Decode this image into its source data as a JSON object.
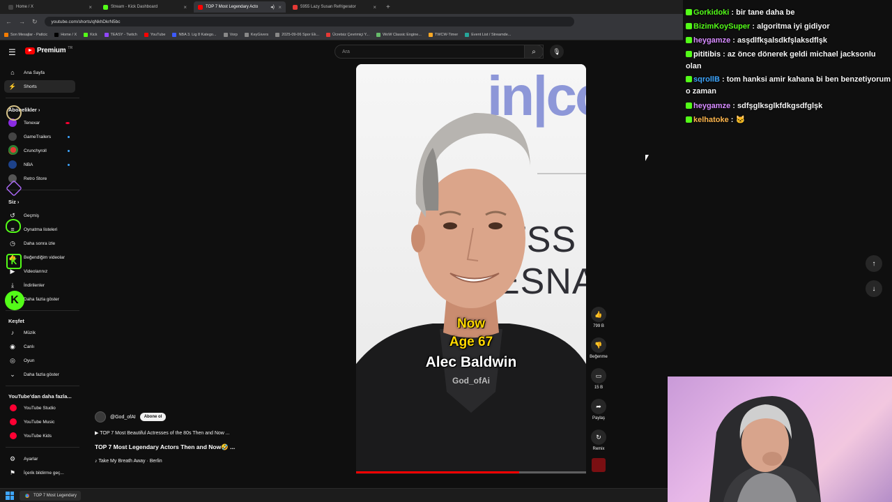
{
  "browser": {
    "tabs": [
      {
        "title": "Home / X",
        "color": "#000000",
        "active": false
      },
      {
        "title": "Stream - Kick Dashboard",
        "color": "#53fc18",
        "active": false
      },
      {
        "title": "TOP 7 Most Legendary Acto",
        "color": "#ff0000",
        "active": true
      },
      {
        "title": "5955 Lazy Susan Refrigerator",
        "color": "#e53935",
        "active": false
      }
    ],
    "url": "youtube.com/shorts/qNkhDkrN5bc",
    "bookmarks": [
      {
        "label": "Son Mesajlar - Patlcic",
        "color": "#f57c00"
      },
      {
        "label": "Home / X",
        "color": "#000000"
      },
      {
        "label": "Kick",
        "color": "#53fc18"
      },
      {
        "label": "TEASY - Twitch",
        "color": "#9146ff"
      },
      {
        "label": "YouTube",
        "color": "#ff0000"
      },
      {
        "label": "NBA 3. Lig 8 Katego...",
        "color": "#3d5afe"
      },
      {
        "label": "Vorp",
        "color": "#888888"
      },
      {
        "label": "KeyGivers",
        "color": "#888888"
      },
      {
        "label": "2025-09-06 Spor Ek...",
        "color": "#888888"
      },
      {
        "label": "Ücretsiz Çevrimiçi Y...",
        "color": "#e53935"
      },
      {
        "label": "WoW Classic Engine...",
        "color": "#66bb6a"
      },
      {
        "label": "TWCW-Timer",
        "color": "#f9a825"
      },
      {
        "label": "Event List / Streamde...",
        "color": "#26a69a"
      }
    ]
  },
  "youtube": {
    "logo_text": "Premium",
    "logo_region": "TR",
    "search_placeholder": "Ara",
    "sidebar": {
      "main": [
        {
          "label": "Ana Sayfa",
          "icon": "home-icon"
        },
        {
          "label": "Shorts",
          "icon": "shorts-icon",
          "active": true
        }
      ],
      "subscriptions_heading": "Abonelikler",
      "channels": [
        {
          "label": "Tenexar",
          "color": "#8a2be2"
        },
        {
          "label": "GameTrailers",
          "color": "#444444"
        },
        {
          "label": "Crunchyroll",
          "color": "#f47521"
        },
        {
          "label": "NBA",
          "color": "#1d428a"
        },
        {
          "label": "Retro Store",
          "color": "#555555"
        }
      ],
      "you_heading": "Siz",
      "you_items": [
        {
          "label": "Geçmiş",
          "icon": "history-icon"
        },
        {
          "label": "Oynatma listeleri",
          "icon": "playlist-icon"
        },
        {
          "label": "Daha sonra izle",
          "icon": "clock-icon"
        },
        {
          "label": "Beğendiğim videolar",
          "icon": "like-icon"
        },
        {
          "label": "Videolarınız",
          "icon": "video-icon"
        },
        {
          "label": "İndirilenler",
          "icon": "download-icon"
        },
        {
          "label": "Daha fazla göster",
          "icon": "chevron-down-icon"
        }
      ],
      "explore_heading": "Keşfet",
      "explore_items": [
        {
          "label": "Müzik",
          "icon": "music-icon"
        },
        {
          "label": "Canlı",
          "icon": "live-icon"
        },
        {
          "label": "Oyun",
          "icon": "gaming-icon"
        },
        {
          "label": "Daha fazla göster",
          "icon": "chevron-down-icon"
        }
      ],
      "more_heading": "YouTube'dan daha fazla...",
      "more_items": [
        {
          "label": "YouTube Studio"
        },
        {
          "label": "YouTube Music"
        },
        {
          "label": "YouTube Kids"
        }
      ],
      "settings_items": [
        {
          "label": "Ayarlar",
          "icon": "gear-icon"
        },
        {
          "label": "İçerik bildirme geç...",
          "icon": "flag-icon"
        }
      ]
    },
    "short": {
      "captions": {
        "now": "Now",
        "age": "Age 67",
        "name": "Alec Baldwin",
        "watermark": "God_ofAi"
      },
      "progress": 0.71,
      "channel_handle": "@God_ofAI",
      "subscribe_label": "Abone ol",
      "playlist": "TOP 7 Most Beautiful Actresses of the 80s Then and Now ...",
      "title": "TOP 7 Most Legendary Actors Then and Now🤣 ...",
      "music": "♪ Take My Breath Away · Berlin",
      "actions": {
        "likes": "799 B",
        "dislike": "Beğenme",
        "comments": "15 B",
        "share": "Paylaş",
        "remix": "Remix"
      }
    }
  },
  "chat": [
    {
      "user": "Gorkidoki",
      "color": "#53fc18",
      "text": "bir tane daha be"
    },
    {
      "user": "BizimKoySuper",
      "color": "#53fc18",
      "text": "algoritma iyi gidiyor"
    },
    {
      "user": "heygamze",
      "color": "#d68bff",
      "text": "asşdlfkşalsdkfşlaksdflşk"
    },
    {
      "user": "pititibis",
      "color": "#ffffff",
      "text": "az önce dönerek geldi michael jacksonlu olan"
    },
    {
      "user": "sqrollB",
      "color": "#3ea6ff",
      "text": "tom hanksi amir kahana bi ben benzetiyorum o zaman"
    },
    {
      "user": "heygamze",
      "color": "#d68bff",
      "text": "sdfşglksglkfdkgsdfglşk"
    },
    {
      "user": "kelhatoke",
      "color": "#ffb74d",
      "text": "🐱"
    }
  ],
  "taskbar": {
    "app_label": "TOP 7 Most Legendary"
  }
}
